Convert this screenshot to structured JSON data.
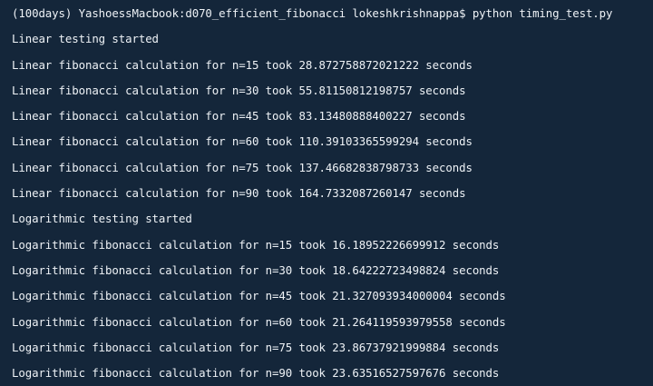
{
  "terminal": {
    "prompt_line": "(100days) YashoessMacbook:d070_efficient_fibonacci lokeshkrishnappa$ python timing_test.py",
    "output_lines": [
      "Linear testing started",
      "Linear fibonacci calculation for n=15 took 28.872758872021222 seconds",
      "Linear fibonacci calculation for n=30 took 55.81150812198757 seconds",
      "Linear fibonacci calculation for n=45 took 83.13480888400227 seconds",
      "Linear fibonacci calculation for n=60 took 110.39103365599294 seconds",
      "Linear fibonacci calculation for n=75 took 137.46682838798733 seconds",
      "Linear fibonacci calculation for n=90 took 164.7332087260147 seconds",
      "Logarithmic testing started",
      "Logarithmic fibonacci calculation for n=15 took 16.18952226699912 seconds",
      "Logarithmic fibonacci calculation for n=30 took 18.64222723498824 seconds",
      "Logarithmic fibonacci calculation for n=45 took 21.327093934000004 seconds",
      "Logarithmic fibonacci calculation for n=60 took 21.264119593979558 seconds",
      "Logarithmic fibonacci calculation for n=75 took 23.86737921999884 seconds",
      "Logarithmic fibonacci calculation for n=90 took 23.63516527597676 seconds"
    ]
  },
  "colors": {
    "background": "#14263a",
    "text": "#eef2f6"
  }
}
